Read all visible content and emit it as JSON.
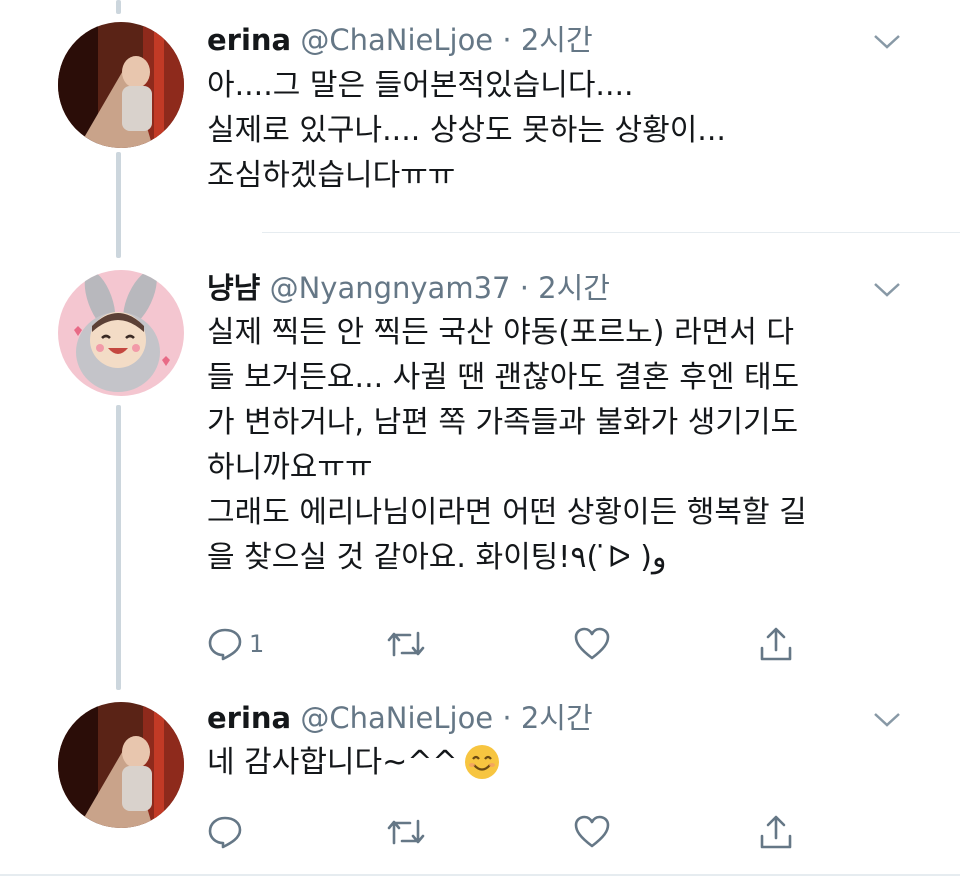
{
  "tweets": [
    {
      "name": "erina",
      "handle": "@ChaNieLjoe",
      "separator": "·",
      "time": "2시간",
      "lines": [
        "아....그 말은 들어본적있습니다....",
        "실제로 있구나.... 상상도 못하는 상황이...",
        "조심하겠습니다ㅠㅠ"
      ],
      "avatar": "photo-avatar"
    },
    {
      "name": "냥냠",
      "handle": "@Nyangnyam37",
      "separator": "·",
      "time": "2시간",
      "lines": [
        "실제 찍든 안 찍든 국산 야동(포르노) 라면서 다",
        "들 보거든요... 사귈 땐 괜찮아도 결혼 후엔 태도",
        "가 변하거나, 남편 쪽 가족들과 불화가 생기기도",
        "하니까요ㅠㅠ",
        "그래도 에리나님이라면 어떤 상황이든 행복할 길",
        "을 찾으실 것 같아요. 화이팅!٩( ̇ᐅ )و"
      ],
      "reply_count": "1",
      "avatar": "bunny-cartoon-avatar"
    },
    {
      "name": "erina",
      "handle": "@ChaNieLjoe",
      "separator": "·",
      "time": "2시간",
      "text": "네 감사합니다~^^",
      "emoji": "smiling-face-emoji",
      "avatar": "photo-avatar"
    }
  ],
  "icons": {
    "reply": "reply-icon",
    "retweet": "retweet-icon",
    "like": "heart-icon",
    "share": "share-icon",
    "more": "chevron-down-icon"
  },
  "colors": {
    "text": "#14171a",
    "secondary": "#657786",
    "thread_line": "#ccd6dd",
    "divider": "#e6ecf0"
  }
}
